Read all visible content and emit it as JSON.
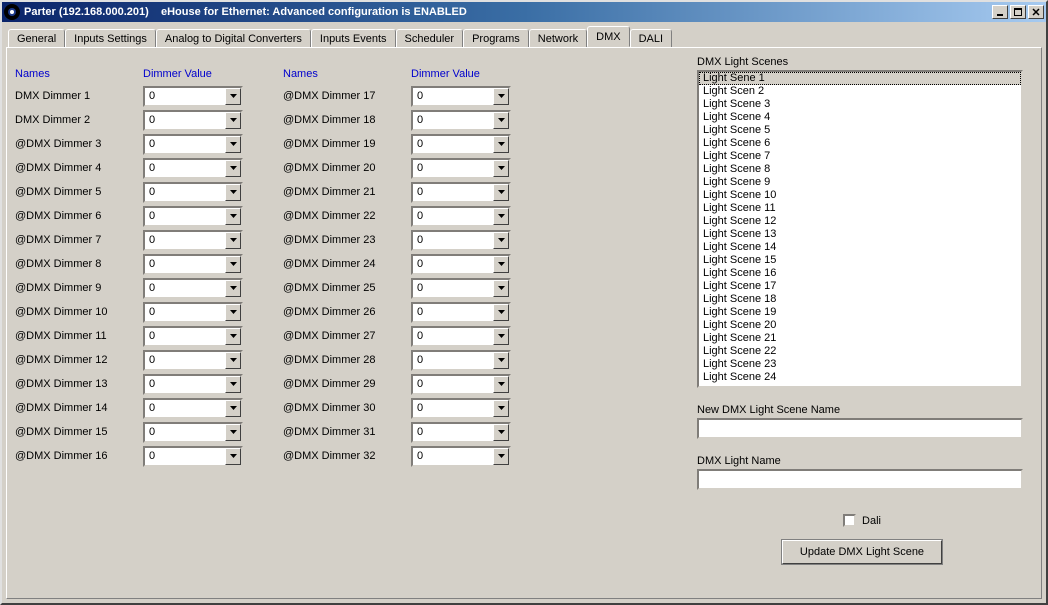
{
  "window": {
    "title": "Parter (192.168.000.201)    eHouse for Ethernet: Advanced configuration is ENABLED"
  },
  "tabs": [
    "General",
    "Inputs Settings",
    "Analog to Digital Converters",
    "Inputs Events",
    "Scheduler",
    "Programs",
    "Network",
    "DMX",
    "DALI"
  ],
  "active_tab": "DMX",
  "headers": {
    "names": "Names",
    "dimmer_value": "Dimmer Value"
  },
  "dimmers_left": [
    {
      "name": "DMX Dimmer 1",
      "value": "0"
    },
    {
      "name": "DMX Dimmer 2",
      "value": "0"
    },
    {
      "name": "@DMX Dimmer 3",
      "value": "0"
    },
    {
      "name": "@DMX Dimmer 4",
      "value": "0"
    },
    {
      "name": "@DMX Dimmer 5",
      "value": "0"
    },
    {
      "name": "@DMX Dimmer 6",
      "value": "0"
    },
    {
      "name": "@DMX Dimmer 7",
      "value": "0"
    },
    {
      "name": "@DMX Dimmer 8",
      "value": "0"
    },
    {
      "name": "@DMX Dimmer 9",
      "value": "0"
    },
    {
      "name": "@DMX Dimmer 10",
      "value": "0"
    },
    {
      "name": "@DMX Dimmer 11",
      "value": "0"
    },
    {
      "name": "@DMX Dimmer 12",
      "value": "0"
    },
    {
      "name": "@DMX Dimmer 13",
      "value": "0"
    },
    {
      "name": "@DMX Dimmer 14",
      "value": "0"
    },
    {
      "name": "@DMX Dimmer 15",
      "value": "0"
    },
    {
      "name": "@DMX Dimmer 16",
      "value": "0"
    }
  ],
  "dimmers_right": [
    {
      "name": "@DMX Dimmer 17",
      "value": "0"
    },
    {
      "name": "@DMX Dimmer 18",
      "value": "0"
    },
    {
      "name": "@DMX Dimmer 19",
      "value": "0"
    },
    {
      "name": "@DMX Dimmer 20",
      "value": "0"
    },
    {
      "name": "@DMX Dimmer 21",
      "value": "0"
    },
    {
      "name": "@DMX Dimmer 22",
      "value": "0"
    },
    {
      "name": "@DMX Dimmer 23",
      "value": "0"
    },
    {
      "name": "@DMX Dimmer 24",
      "value": "0"
    },
    {
      "name": "@DMX Dimmer 25",
      "value": "0"
    },
    {
      "name": "@DMX Dimmer 26",
      "value": "0"
    },
    {
      "name": "@DMX Dimmer 27",
      "value": "0"
    },
    {
      "name": "@DMX Dimmer 28",
      "value": "0"
    },
    {
      "name": "@DMX Dimmer 29",
      "value": "0"
    },
    {
      "name": "@DMX Dimmer 30",
      "value": "0"
    },
    {
      "name": "@DMX Dimmer 31",
      "value": "0"
    },
    {
      "name": "@DMX Dimmer 32",
      "value": "0"
    }
  ],
  "right_panel": {
    "scenes_label": "DMX Light Scenes",
    "scenes": [
      "Light Sene 1",
      "Light Scen 2",
      "Light Scene 3",
      "Light Scene 4",
      "Light Scene 5",
      "Light Scene 6",
      "Light Scene 7",
      "Light Scene 8",
      "Light Scene 9",
      "Light Scene 10",
      "Light Scene 11",
      "Light Scene 12",
      "Light Scene 13",
      "Light Scene 14",
      "Light Scene 15",
      "Light Scene 16",
      "Light Scene 17",
      "Light Scene 18",
      "Light Scene 19",
      "Light Scene 20",
      "Light Scene 21",
      "Light Scene 22",
      "Light Scene 23",
      "Light Scene 24"
    ],
    "selected_scene_index": 0,
    "new_scene_label": "New DMX Light Scene Name",
    "new_scene_value": "",
    "light_name_label": "DMX Light Name",
    "light_name_value": "",
    "dali_label": "Dali",
    "dali_checked": false,
    "update_btn": "Update DMX Light Scene"
  }
}
